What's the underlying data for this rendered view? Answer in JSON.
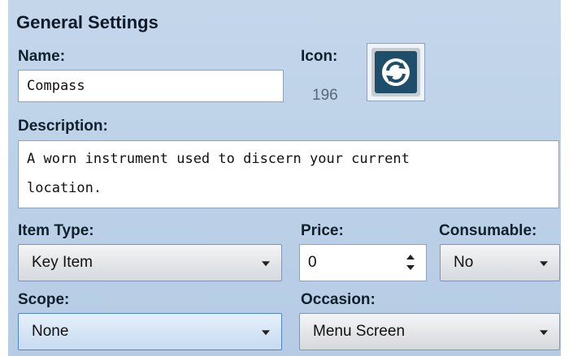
{
  "section": {
    "title": "General Settings"
  },
  "name": {
    "label": "Name:",
    "value": "Compass"
  },
  "icon": {
    "label": "Icon:",
    "index": "196",
    "symbol": "compass-swirl-icon"
  },
  "description": {
    "label": "Description:",
    "line1": "A worn instrument used to discern your current",
    "line2": "location."
  },
  "item_type": {
    "label": "Item Type:",
    "value": "Key Item"
  },
  "price": {
    "label": "Price:",
    "value": "0"
  },
  "consumable": {
    "label": "Consumable:",
    "value": "No"
  },
  "scope": {
    "label": "Scope:",
    "value": "None"
  },
  "occasion": {
    "label": "Occasion:",
    "value": "Menu Screen"
  },
  "colors": {
    "panel_bg": "#bcd1e8",
    "icon_tile": "#1f4e6a",
    "focus_border": "#4f84c6"
  }
}
